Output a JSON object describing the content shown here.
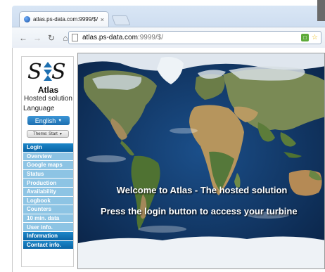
{
  "browser": {
    "tab_title": "atlas.ps-data.com:9999/$/",
    "tab_close": "×",
    "url_host": "atlas.ps-data.com",
    "url_rest": ":9999/$/"
  },
  "sidebar": {
    "title": "Atlas",
    "subtitle": "Hosted solution",
    "language_label": "Language",
    "language_value": "English",
    "theme_value": "Theme: Start",
    "menu": [
      {
        "label": "Login",
        "style": "dark"
      },
      {
        "label": "Overview",
        "style": "light"
      },
      {
        "label": "Google maps",
        "style": "light"
      },
      {
        "label": "Status",
        "style": "light"
      },
      {
        "label": "Production",
        "style": "light"
      },
      {
        "label": "Availability",
        "style": "light"
      },
      {
        "label": "Logbook",
        "style": "light"
      },
      {
        "label": "Counters",
        "style": "light"
      },
      {
        "label": "10 min. data",
        "style": "light"
      },
      {
        "label": "User info.",
        "style": "light"
      },
      {
        "label": "Information",
        "style": "dark"
      },
      {
        "label": "Contact info.",
        "style": "dark"
      }
    ]
  },
  "main": {
    "welcome": "Welcome to Atlas - The hosted solution",
    "instruction": "Press the login button to access your turbine"
  },
  "colors": {
    "menu_dark": "#0a64a4",
    "menu_light": "#8dc4e4",
    "ocean": "#0d2c5a"
  }
}
